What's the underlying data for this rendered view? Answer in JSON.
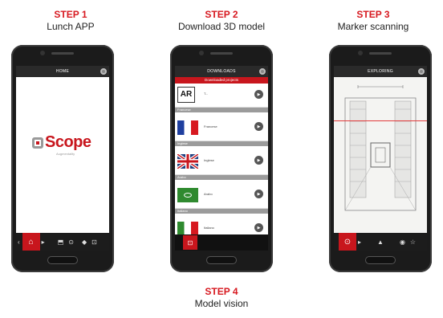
{
  "steps": [
    {
      "num": "STEP 1",
      "desc": "Lunch APP"
    },
    {
      "num": "STEP 2",
      "desc": "Download 3D model"
    },
    {
      "num": "STEP 3",
      "desc": "Marker scanning"
    },
    {
      "num": "STEP 4",
      "desc": "Model vision"
    }
  ],
  "phone1": {
    "header": "HOME",
    "logo": "Scope",
    "logo_sub": "Augmentality"
  },
  "phone2": {
    "header": "DOWNLOADS",
    "banner": "Downloaded projects",
    "items": [
      {
        "category": "",
        "name": "T..."
      },
      {
        "category": "Francese",
        "name": "Francese"
      },
      {
        "category": "Inglese",
        "name": "Inglese"
      },
      {
        "category": "Arabo",
        "name": "Arabo"
      },
      {
        "category": "Italiano",
        "name": "Italiano"
      }
    ],
    "ar_logo": "AR"
  },
  "phone3": {
    "header": "EXPLORING"
  },
  "colors": {
    "accent": "#c8161d",
    "phone_body": "#1b1b1b"
  }
}
